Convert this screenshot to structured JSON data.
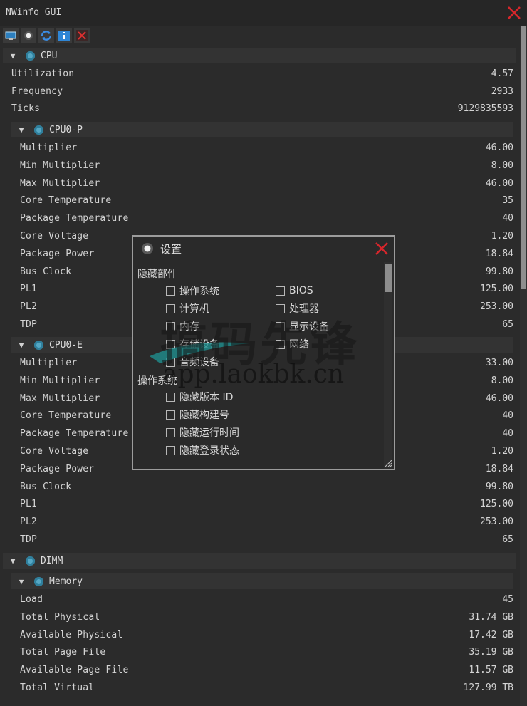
{
  "app": {
    "title": "NWinfo GUI"
  },
  "toolbar": {
    "buttons": [
      {
        "icon": "monitor-icon"
      },
      {
        "icon": "settings-icon"
      },
      {
        "icon": "refresh-icon"
      },
      {
        "icon": "info-icon"
      },
      {
        "icon": "close-icon"
      }
    ]
  },
  "cpu": {
    "label": "CPU",
    "rows": [
      {
        "k": "Utilization",
        "v": "4.57"
      },
      {
        "k": "Frequency",
        "v": "2933"
      },
      {
        "k": "Ticks",
        "v": "9129835593"
      }
    ],
    "p": {
      "label": "CPU0-P",
      "rows": [
        {
          "k": "Multiplier",
          "v": "46.00"
        },
        {
          "k": "Min Multiplier",
          "v": "8.00"
        },
        {
          "k": "Max Multiplier",
          "v": "46.00"
        },
        {
          "k": "Core Temperature",
          "v": "35"
        },
        {
          "k": "Package Temperature",
          "v": "40"
        },
        {
          "k": "Core Voltage",
          "v": "1.20"
        },
        {
          "k": "Package Power",
          "v": "18.84"
        },
        {
          "k": "Bus Clock",
          "v": "99.80"
        },
        {
          "k": "PL1",
          "v": "125.00"
        },
        {
          "k": "PL2",
          "v": "253.00"
        },
        {
          "k": "TDP",
          "v": "65"
        }
      ]
    },
    "e": {
      "label": "CPU0-E",
      "rows": [
        {
          "k": "Multiplier",
          "v": "33.00"
        },
        {
          "k": "Min Multiplier",
          "v": "8.00"
        },
        {
          "k": "Max Multiplier",
          "v": "46.00"
        },
        {
          "k": "Core Temperature",
          "v": "40"
        },
        {
          "k": "Package Temperature",
          "v": "40"
        },
        {
          "k": "Core Voltage",
          "v": "1.20"
        },
        {
          "k": "Package Power",
          "v": "18.84"
        },
        {
          "k": "Bus Clock",
          "v": "99.80"
        },
        {
          "k": "PL1",
          "v": "125.00"
        },
        {
          "k": "PL2",
          "v": "253.00"
        },
        {
          "k": "TDP",
          "v": "65"
        }
      ]
    }
  },
  "dimm": {
    "label": "DIMM",
    "memory": {
      "label": "Memory",
      "rows": [
        {
          "k": "Load",
          "v": "45"
        },
        {
          "k": "Total Physical",
          "v": "31.74 GB"
        },
        {
          "k": "Available Physical",
          "v": "17.42 GB"
        },
        {
          "k": "Total Page File",
          "v": "35.19 GB"
        },
        {
          "k": "Available Page File",
          "v": "11.57 GB"
        },
        {
          "k": "Total Virtual",
          "v": "127.99 TB"
        }
      ]
    }
  },
  "dialog": {
    "title": "设置",
    "group1": "隐藏部件",
    "left": [
      "操作系统",
      "计算机",
      "内存",
      "存储设备",
      "音频设备"
    ],
    "right": [
      "BIOS",
      "处理器",
      "显示设备",
      "网络"
    ],
    "group2": "操作系统",
    "options": [
      "隐藏版本 ID",
      "隐藏构建号",
      "隐藏运行时间",
      "隐藏登录状态"
    ]
  },
  "watermark": {
    "line1": "搞码先锋",
    "line2": "app.laokbk.cn"
  }
}
